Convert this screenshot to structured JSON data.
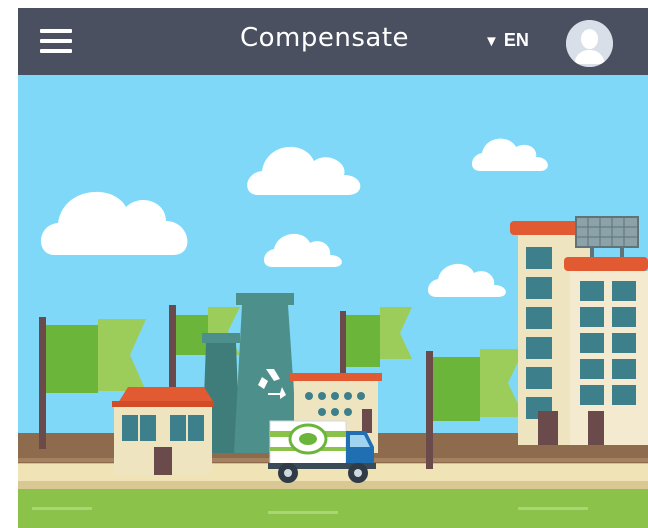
{
  "header": {
    "title": "Compensate",
    "language": "EN",
    "icons": {
      "menu": "hamburger-menu-icon",
      "language_caret": "triangle-down-icon",
      "avatar": "user-avatar-icon"
    }
  },
  "illustration": {
    "icons": [
      "cloud",
      "flag",
      "factory-chimney",
      "recycle-icon",
      "house",
      "delivery-truck",
      "apartment-building",
      "solar-panel"
    ],
    "colors": {
      "sky": "#7fd8f8",
      "cloud": "#ffffff",
      "flag_dark": "#6bb53a",
      "flag_light": "#9ccc5a",
      "pole": "#6a4a4a",
      "chimney": "#4d8f8b",
      "ground": "#8f6b4e",
      "road_stripe": "#a3a3a3",
      "sand": "#f0e3b5",
      "grass": "#8bc34a",
      "building": "#efe4c0",
      "roof": "#e25a32",
      "window": "#3d7f8a"
    }
  }
}
